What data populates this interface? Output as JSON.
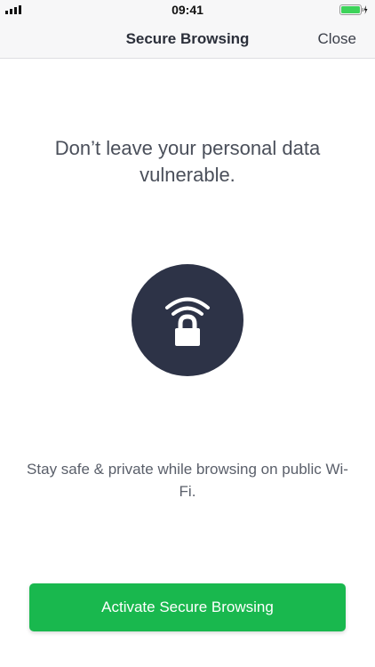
{
  "status_bar": {
    "time": "09:41",
    "signal_icon": "signal-bars-icon",
    "battery_icon": "battery-charging-icon"
  },
  "nav": {
    "title": "Secure Browsing",
    "close_label": "Close"
  },
  "content": {
    "headline": "Don’t leave your personal data vulnerable.",
    "illustration_icon": "wifi-lock-icon",
    "subtext": "Stay safe & private while browsing on public Wi-Fi."
  },
  "cta": {
    "label": "Activate Secure Browsing"
  },
  "colors": {
    "accent_green": "#19b84e",
    "icon_circle": "#2d3347",
    "battery_green": "#3dd35a"
  }
}
